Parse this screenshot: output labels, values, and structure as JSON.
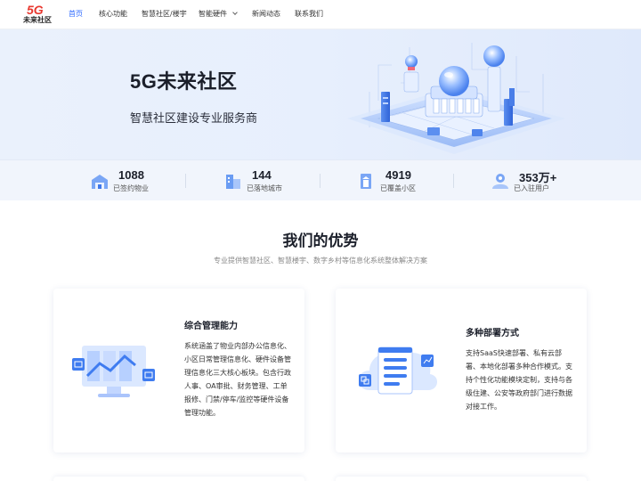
{
  "brand": {
    "logo_mark": "5G",
    "logo_name": "未来社区"
  },
  "nav": {
    "items": [
      {
        "label": "首页",
        "active": true
      },
      {
        "label": "核心功能"
      },
      {
        "label": "智慧社区/楼宇"
      },
      {
        "label": "智能硬件",
        "has_dropdown": true
      },
      {
        "label": "新闻动态"
      },
      {
        "label": "联系我们"
      }
    ]
  },
  "hero": {
    "title": "5G未来社区",
    "subtitle": "智慧社区建设专业服务商"
  },
  "stats": [
    {
      "value": "1088",
      "label": "已签约物业",
      "icon": "building-icon"
    },
    {
      "value": "144",
      "label": "已落地城市",
      "icon": "city-icon"
    },
    {
      "value": "4919",
      "label": "已覆盖小区",
      "icon": "community-icon"
    },
    {
      "value": "353万+",
      "label": "已入驻用户",
      "icon": "users-icon"
    }
  ],
  "advantages": {
    "title": "我们的优势",
    "subtitle": "专业提供智慧社区、智慧楼宇、数字乡村等信息化系统整体解决方案",
    "cards": [
      {
        "title": "综合管理能力",
        "lines": [
          "系统涵盖了物业内部办公信息化、",
          "小区日常管理信息化、硬件设备管",
          "理信息化三大核心板块。包含行政",
          "人事、OA审批、财务管理、工单",
          "报修、门禁/停车/监控等硬件设备",
          "管理功能。"
        ]
      },
      {
        "title": "多种部署方式",
        "lines": [
          "支持SaaS快速部署、私有云部",
          "署、本地化部署多种合作模式。支",
          "持个性化功能模块定制，支持与各",
          "级住建、公安等政府部门进行数据",
          "对接工作。"
        ]
      }
    ]
  },
  "colors": {
    "accent": "#2f6bff",
    "brand_red": "#e8382f",
    "hero_bg": "#e7effd"
  }
}
